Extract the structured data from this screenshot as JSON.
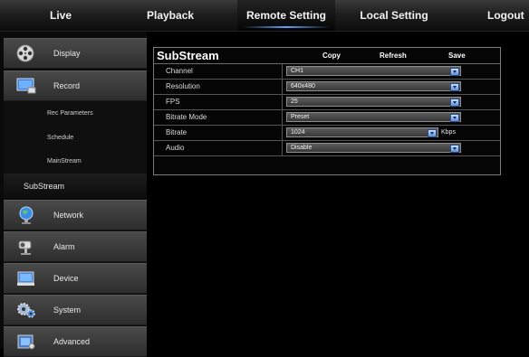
{
  "topnav": {
    "tabs": [
      {
        "label": "Live"
      },
      {
        "label": "Playback"
      },
      {
        "label": "Remote Setting",
        "active": true
      },
      {
        "label": "Local Setting"
      },
      {
        "label": "Logout"
      }
    ]
  },
  "sidebar": {
    "items": [
      {
        "label": "Display",
        "icon": "film-reel-icon"
      },
      {
        "label": "Record",
        "icon": "monitor-icon"
      },
      {
        "label": "Rec Parameters"
      },
      {
        "label": "Schedule"
      },
      {
        "label": "MainStream"
      },
      {
        "label": "SubStream",
        "active": true
      },
      {
        "label": "Network",
        "icon": "globe-icon"
      },
      {
        "label": "Alarm",
        "icon": "camera-alarm-icon"
      },
      {
        "label": "Device",
        "icon": "device-icon"
      },
      {
        "label": "System",
        "icon": "gears-icon"
      },
      {
        "label": "Advanced",
        "icon": "advanced-icon"
      }
    ]
  },
  "panel": {
    "title": "SubStream",
    "copy_label": "Copy",
    "refresh_label": "Refresh",
    "save_label": "Save",
    "rows": [
      {
        "label": "Channel",
        "value": "CH1"
      },
      {
        "label": "Resolution",
        "value": "640x480"
      },
      {
        "label": "FPS",
        "value": "25"
      },
      {
        "label": "Bitrate Mode",
        "value": "Preset"
      },
      {
        "label": "Bitrate",
        "value": "1024",
        "unit": "Kbps"
      },
      {
        "label": "Audio",
        "value": "Disable"
      }
    ]
  },
  "colors": {
    "accent": "#5aa6ff",
    "dropdown": "#5f8fd8"
  }
}
